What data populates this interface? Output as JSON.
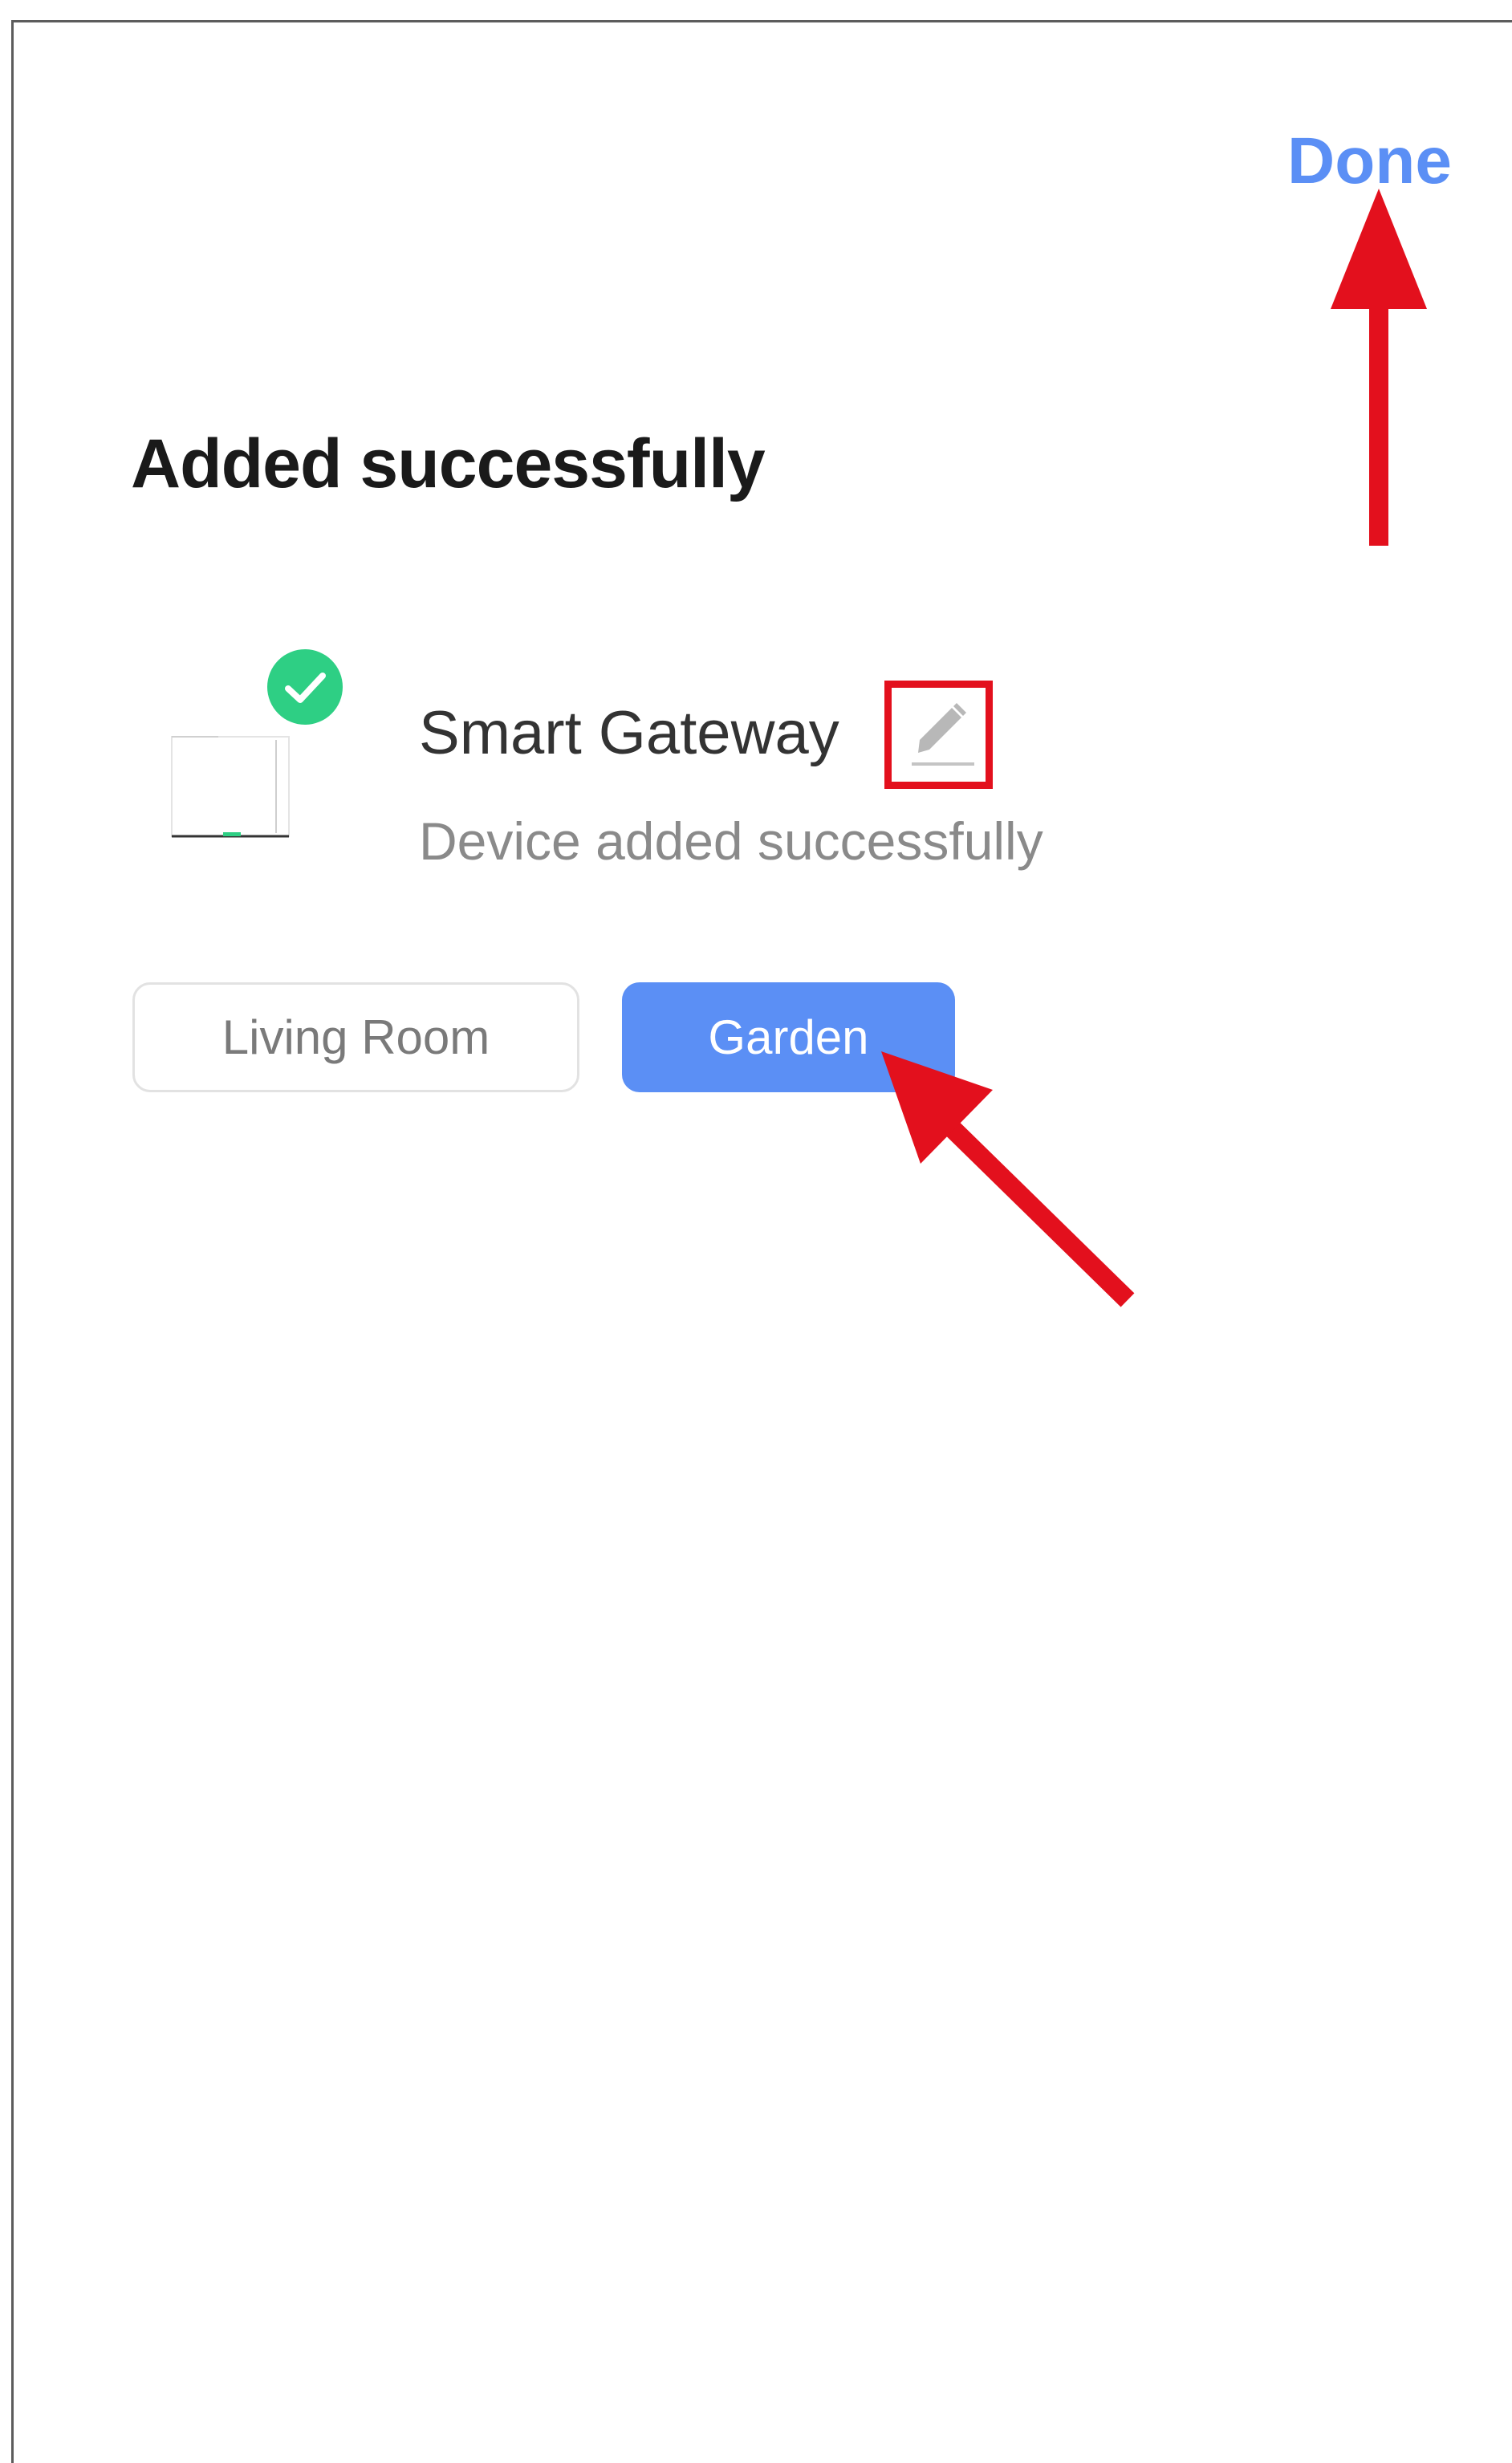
{
  "header": {
    "done_label": "Done"
  },
  "main": {
    "title": "Added successfully",
    "device": {
      "name": "Smart Gateway",
      "status": "Device added successfully",
      "image_icon": "gateway-device-icon",
      "badge_icon": "check-icon",
      "edit_icon": "pencil-icon"
    },
    "rooms": [
      {
        "label": "Living Room",
        "selected": false
      },
      {
        "label": "Garden",
        "selected": true
      }
    ]
  },
  "colors": {
    "accent": "#5b8ff5",
    "success": "#2ecf84",
    "annotation": "#e3101d",
    "title": "#1a1a1a",
    "secondary_text": "#8a8a8a"
  }
}
